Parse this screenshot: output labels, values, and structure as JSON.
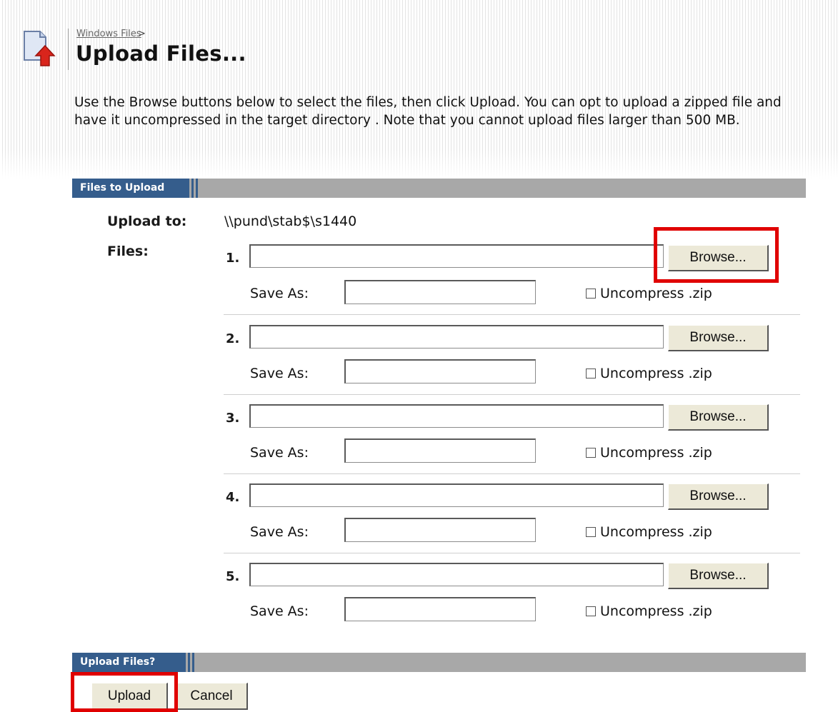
{
  "header": {
    "breadcrumb_link": "Windows Files",
    "breadcrumb_separator": ">",
    "title": "Upload Files...",
    "intro": "Use the Browse buttons below to select the files, then click Upload. You can opt to upload a zipped file and have it uncompressed in the target directory . Note that you cannot upload files larger than 500 MB."
  },
  "files_section": {
    "heading": "Files to Upload",
    "upload_to_label": "Upload to:",
    "upload_to_value": "\\\\pund\\stab$\\s1440",
    "files_label": "Files:",
    "rows": [
      {
        "num": "1.",
        "file_value": "",
        "browse": "Browse...",
        "save_as_label": "Save As:",
        "save_as_value": "",
        "uncompress": "Uncompress .zip",
        "uncompress_checked": false
      },
      {
        "num": "2.",
        "file_value": "",
        "browse": "Browse...",
        "save_as_label": "Save As:",
        "save_as_value": "",
        "uncompress": "Uncompress .zip",
        "uncompress_checked": false
      },
      {
        "num": "3.",
        "file_value": "",
        "browse": "Browse...",
        "save_as_label": "Save As:",
        "save_as_value": "",
        "uncompress": "Uncompress .zip",
        "uncompress_checked": false
      },
      {
        "num": "4.",
        "file_value": "",
        "browse": "Browse...",
        "save_as_label": "Save As:",
        "save_as_value": "",
        "uncompress": "Uncompress .zip",
        "uncompress_checked": false
      },
      {
        "num": "5.",
        "file_value": "",
        "browse": "Browse...",
        "save_as_label": "Save As:",
        "save_as_value": "",
        "uncompress": "Uncompress .zip",
        "uncompress_checked": false
      }
    ]
  },
  "actions_section": {
    "heading": "Upload Files?",
    "upload_label": "Upload",
    "cancel_label": "Cancel"
  },
  "colors": {
    "section_bar": "#355d8c",
    "section_track": "#a8a8a8",
    "highlight": "#e00000",
    "button_face": "#ece9d8"
  }
}
